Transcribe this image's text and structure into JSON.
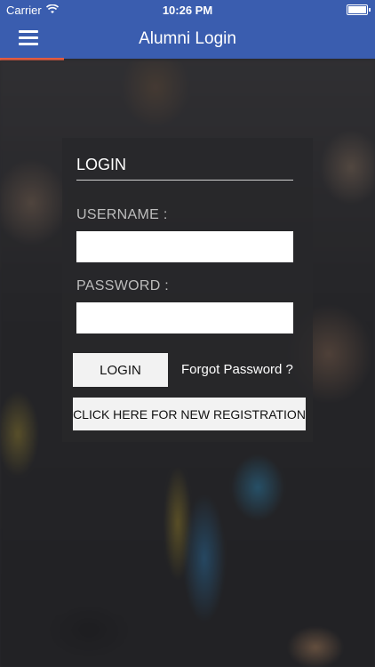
{
  "status_bar": {
    "carrier": "Carrier",
    "time": "10:26 PM",
    "wifi_icon": "wifi-icon",
    "battery_icon": "battery-icon"
  },
  "nav": {
    "title": "Alumni Login",
    "menu_icon": "hamburger-menu-icon"
  },
  "login": {
    "title": "LOGIN",
    "username_label": "USERNAME :",
    "username_value": "",
    "password_label": "PASSWORD :",
    "password_value": "",
    "login_button": "LOGIN",
    "forgot_link": "Forgot Password ?",
    "register_button": "CLICK HERE FOR NEW REGISTRATION"
  },
  "colors": {
    "nav_bar": "#3a5daf",
    "accent": "#e85c41"
  }
}
